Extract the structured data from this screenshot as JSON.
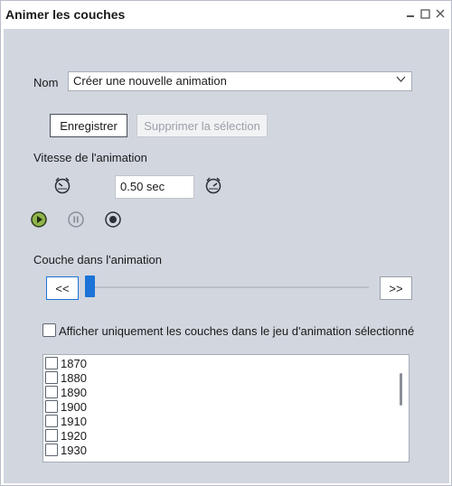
{
  "window": {
    "title": "Animer les couches"
  },
  "name_field": {
    "label": "Nom",
    "value": "Créer une nouvelle animation"
  },
  "buttons": {
    "save": "Enregistrer",
    "delete_selection": "Supprimer la sélection"
  },
  "speed": {
    "label": "Vitesse de l'animation",
    "value": "0.50 sec"
  },
  "layer_section": {
    "label": "Couche dans l'animation",
    "prev": "<<",
    "next": ">>",
    "position": 0
  },
  "filter": {
    "label": "Afficher uniquement les couches dans le jeu d'animation sélectionné",
    "checked": false
  },
  "layers": [
    "1870",
    "1880",
    "1890",
    "1900",
    "1910",
    "1920",
    "1930"
  ],
  "colors": {
    "accent": "#1b73d8",
    "panel_bg": "#d1d6df",
    "play_green": "#6a9a2a"
  }
}
